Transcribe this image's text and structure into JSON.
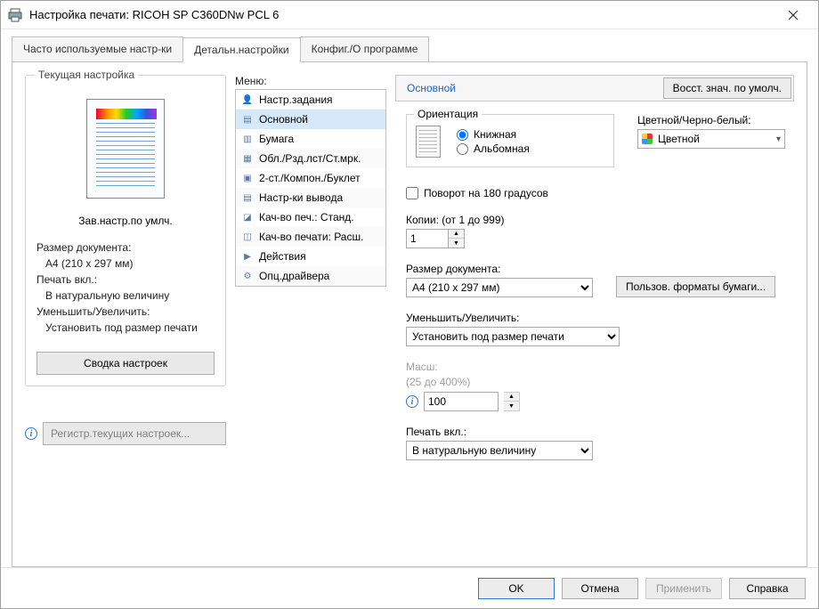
{
  "window": {
    "title": "Настройка печати: RICOH SP C360DNw PCL 6"
  },
  "tabs": {
    "freq": "Часто используемые настр-ки",
    "detail": "Детальн.настройки",
    "config": "Конфиг./О программе"
  },
  "preview": {
    "group_label": "Текущая настройка",
    "title": "Зав.настр.по умлч.",
    "docsize_label": "Размер документа:",
    "docsize_value": "A4 (210 x 297 мм)",
    "print_on_label": "Печать вкл.:",
    "print_on_value": "В натуральную величину",
    "scale_label": "Уменьшить/Увеличить:",
    "scale_value": "Установить под размер печати",
    "summary_btn": "Сводка настроек",
    "register_btn": "Регистр.текущих настроек..."
  },
  "menu": {
    "label": "Меню:",
    "items": [
      "Настр.задания",
      "Основной",
      "Бумага",
      "Обл./Рзд.лст/Ст.мрк.",
      "2-ст./Компон./Буклет",
      "Настр-ки вывода",
      "Кач-во печ.: Станд.",
      "Кач-во печати: Расш.",
      "Действия",
      "Опц.драйвера"
    ]
  },
  "panel": {
    "title": "Основной",
    "restore_btn": "Восст. знач. по умолч.",
    "orientation": {
      "label": "Ориентация",
      "portrait": "Книжная",
      "landscape": "Альбомная"
    },
    "color": {
      "label": "Цветной/Черно-белый:",
      "value": "Цветной"
    },
    "rotate180": "Поворот на 180 градусов",
    "copies": {
      "label": "Копии: (от 1 до 999)",
      "value": "1"
    },
    "docsize": {
      "label": "Размер документа:",
      "value": "A4 (210 x 297 мм)",
      "custom_btn": "Пользов. форматы бумаги..."
    },
    "scale": {
      "label": "Уменьшить/Увеличить:",
      "value": "Установить под размер печати"
    },
    "zoom": {
      "label": "Масш:",
      "range": "(25 до 400%)",
      "value": "100"
    },
    "print_on": {
      "label": "Печать вкл.:",
      "value": "В натуральную величину"
    }
  },
  "footer": {
    "ok": "OK",
    "cancel": "Отмена",
    "apply": "Применить",
    "help": "Справка"
  }
}
